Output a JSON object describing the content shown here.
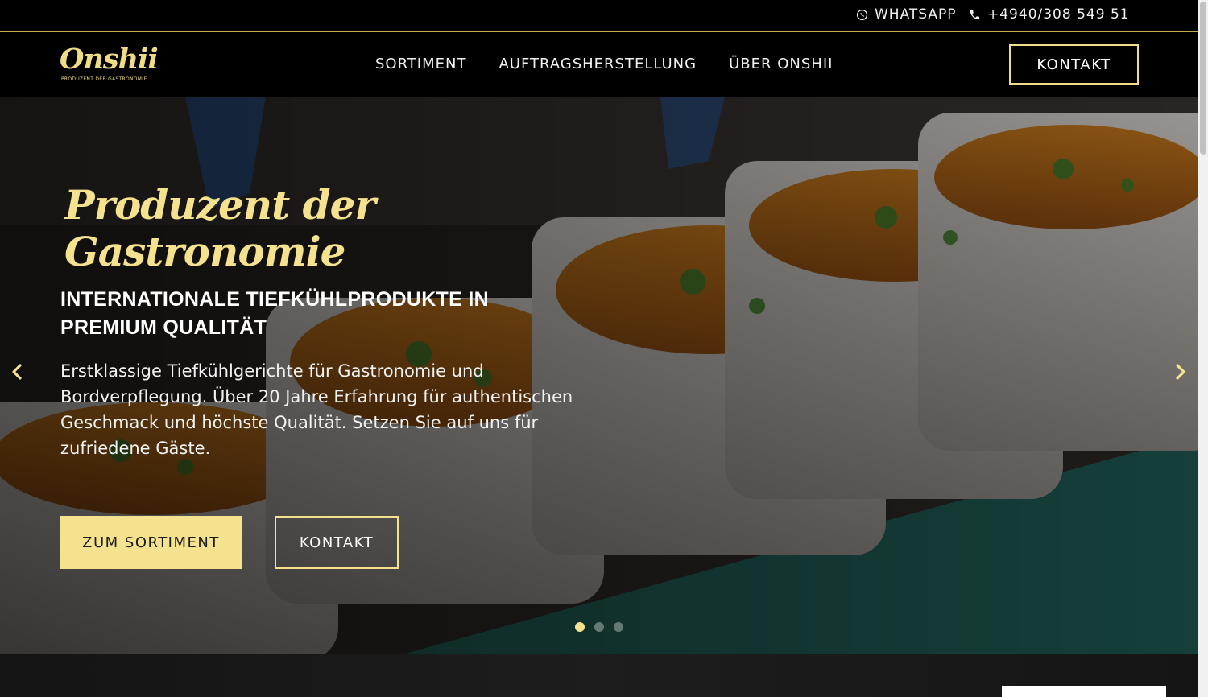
{
  "topbar": {
    "whatsapp_label": "WHATSAPP",
    "phone_label": "+4940/308 549 51"
  },
  "header": {
    "logo_text": "Onshii",
    "logo_tagline": "PRODUZENT DER GASTRONOMIE",
    "nav": [
      {
        "label": "SORTIMENT"
      },
      {
        "label": "AUFTRAGSHERSTELLUNG"
      },
      {
        "label": "ÜBER ONSHII"
      }
    ],
    "contact_button": "KONTAKT"
  },
  "hero": {
    "title_line1": "Produzent der",
    "title_line2": "Gastronomie",
    "subtitle_line1": "INTERNATIONALE TIEFKÜHLPRODUKTE IN",
    "subtitle_line2": "PREMIUM QUALITÄT",
    "text": "Erstklassige Tiefkühlgerichte für Gastronomie und Bordverpflegung. Über 20 Jahre Erfahrung für authentischen Geschmack und höchste Qualität. Setzen Sie auf uns für zufriedene Gäste.",
    "primary_button": "ZUM SORTIMENT",
    "secondary_button": "KONTAKT",
    "slide_count": 3,
    "active_slide": 1
  },
  "colors": {
    "accent": "#f5e28e",
    "topbar_line": "#c9a94b",
    "background": "#000000"
  }
}
